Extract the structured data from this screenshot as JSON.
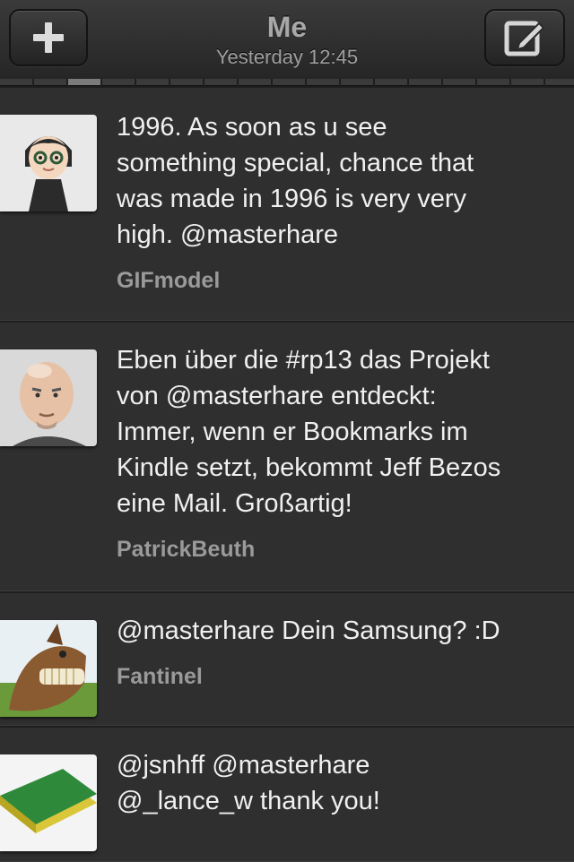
{
  "header": {
    "title": "Me",
    "subtitle": "Yesterday 12:45",
    "add_icon": "plus-icon",
    "compose_icon": "compose-icon"
  },
  "page_indicator": {
    "count": 17,
    "active": 2
  },
  "tweets": [
    {
      "text": "1996. As soon as u see\nsomething special, chance that\nwas made in 1996 is very very\nhigh. @masterhare",
      "user": "GIFmodel",
      "avatar": "mii-avatar"
    },
    {
      "text": "Eben über die #rp13 das Projekt\nvon @masterhare entdeckt:\nImmer, wenn er Bookmarks im\nKindle setzt, bekommt Jeff Bezos\neine Mail. Großartig!",
      "user": "PatrickBeuth",
      "avatar": "bald-man-avatar"
    },
    {
      "text": "@masterhare Dein Samsung? :D",
      "user": "Fantinel",
      "avatar": "horse-avatar"
    },
    {
      "text": "@jsnhff @masterhare\n@_lance_w thank you!",
      "user": "",
      "avatar": "sponge-avatar"
    }
  ],
  "colors": {
    "background": "#2f2f2f",
    "tweet_text": "#f0f0f0",
    "username": "#9a9a9a",
    "header_text": "#a8a8a8"
  }
}
